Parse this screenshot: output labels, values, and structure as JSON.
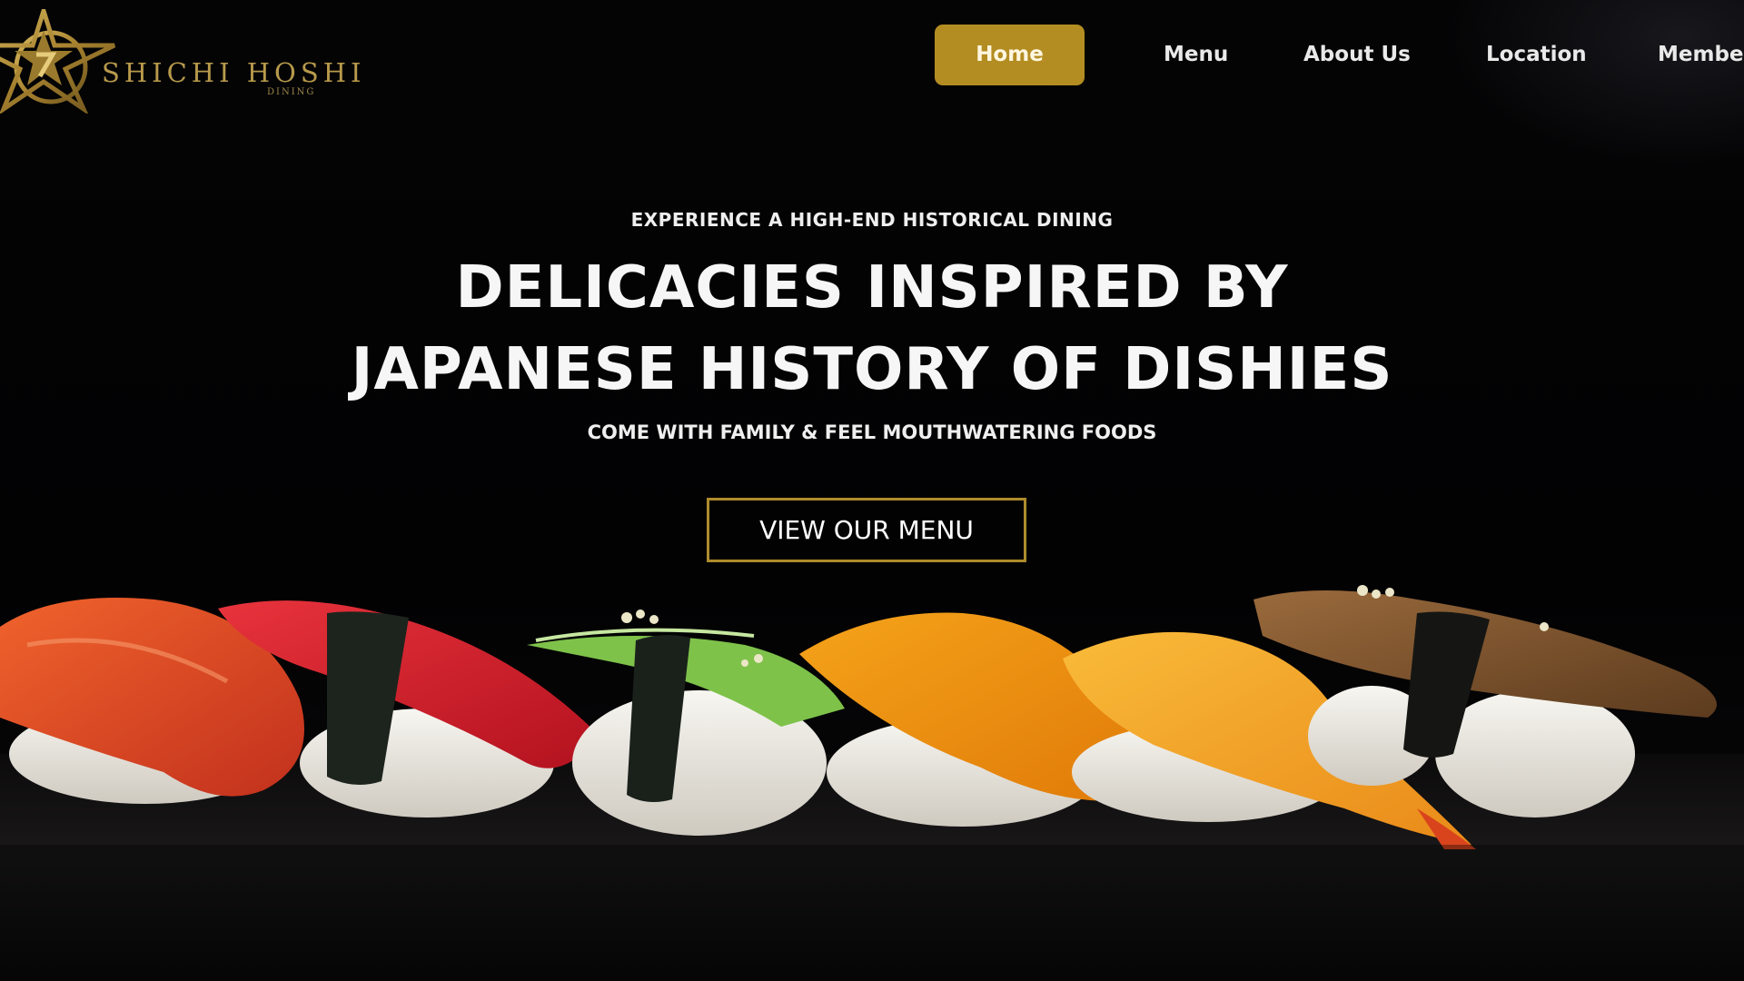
{
  "brand": {
    "name": "SHICHI HOSHI",
    "sub": "DINING",
    "accent": "#b38d22"
  },
  "nav": {
    "home": "Home",
    "menu": "Menu",
    "about": "About Us",
    "location": "Location",
    "member": "Member"
  },
  "hero": {
    "eyebrow": "EXPERIENCE A HIGH-END HISTORICAL DINING",
    "headline_line1": "DELICACIES INSPIRED BY",
    "headline_line2": "JAPANESE HISTORY OF DISHIES",
    "tagline": "COME WITH FAMILY & FEEL MOUTHWATERING FOODS",
    "cta": "VIEW OUR MENU"
  },
  "image": {
    "subject": "sushi-nigiri-row"
  }
}
